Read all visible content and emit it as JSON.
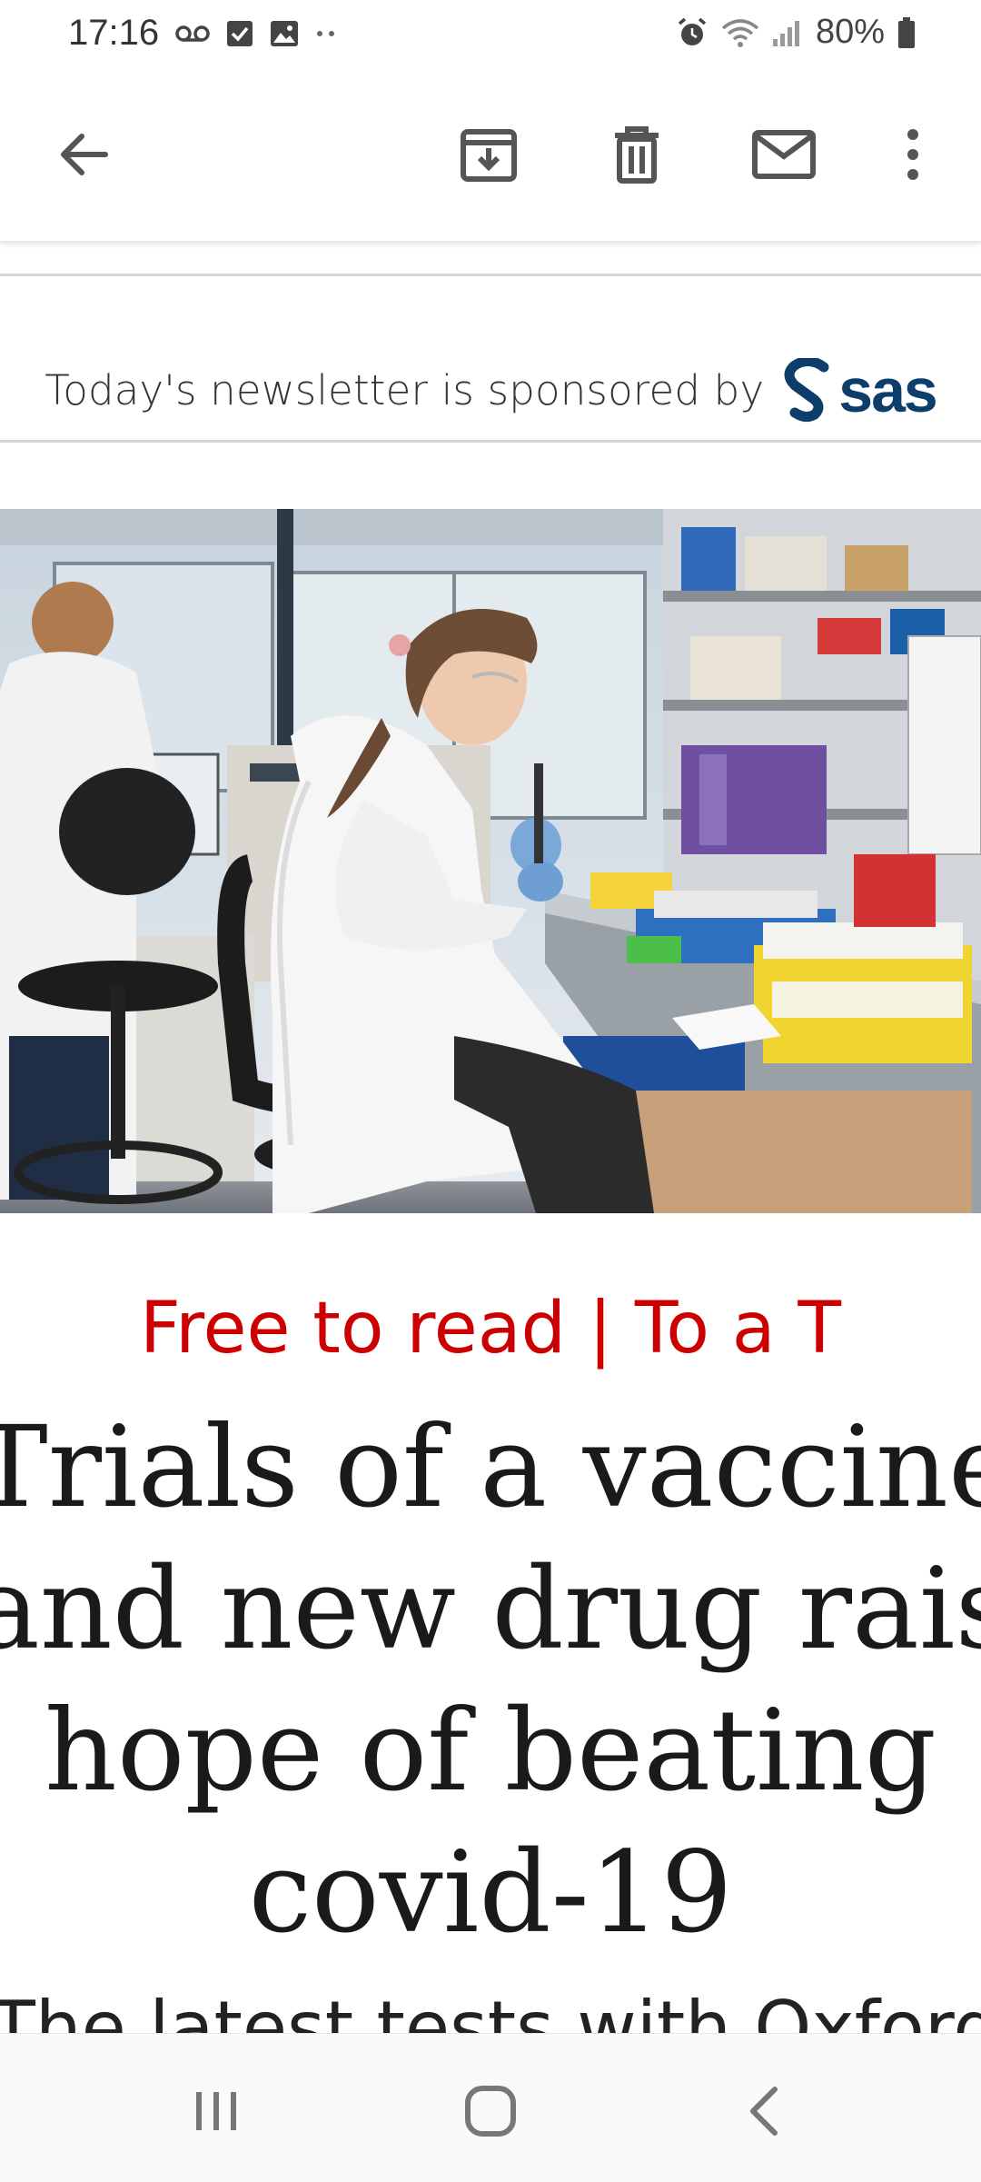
{
  "status_bar": {
    "time": "17:16",
    "battery": "80%",
    "left_icons": [
      "voicemail-icon",
      "checkbox-icon",
      "image-icon",
      "more-dots-icon"
    ],
    "right_icons": [
      "alarm-icon",
      "wifi-icon",
      "signal-icon",
      "battery-icon"
    ]
  },
  "toolbar": {
    "back": "back-arrow-icon",
    "archive": "archive-icon",
    "delete": "trash-icon",
    "mark_unread": "mail-icon",
    "more": "more-vert-icon"
  },
  "sponsor": {
    "text": "Today's newsletter is sponsored by",
    "logo_text": "sas"
  },
  "article": {
    "kicker": "Free to read | To a T",
    "headline_lines": [
      "Trials of a vaccine",
      "and new drug raise",
      "hope of beating",
      "covid-19"
    ],
    "teaser": "The latest tests with Oxford"
  },
  "nav_bar": {
    "recents": "recents-icon",
    "home": "home-icon",
    "back": "nav-back-icon"
  },
  "colors": {
    "kicker": "#cc0000",
    "sas_brand": "#0c3d6b",
    "headline": "#1a1a1a"
  }
}
